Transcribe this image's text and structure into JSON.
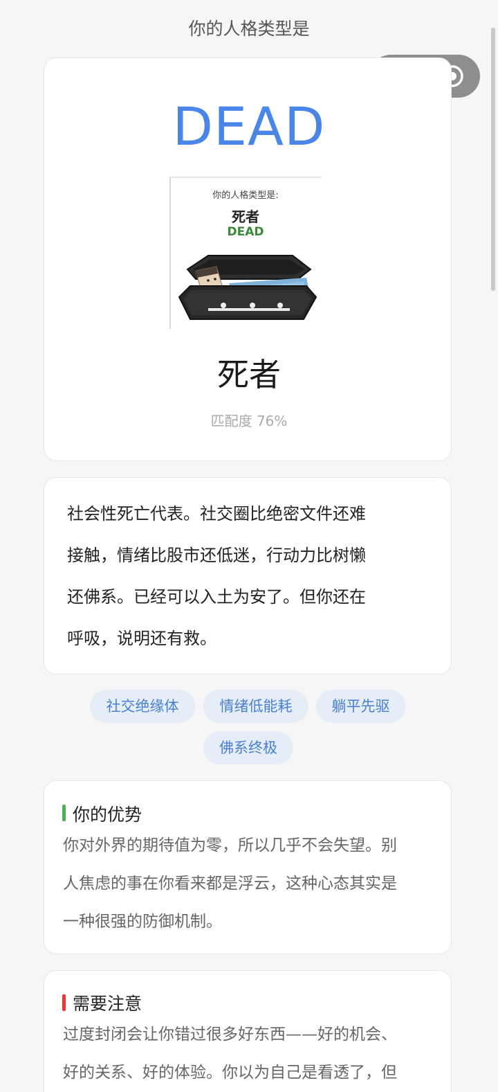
{
  "nav": {
    "title": "你的人格类型是"
  },
  "capsule": {
    "more_icon": "more-dots-icon",
    "close_icon": "target-circle-icon"
  },
  "result": {
    "code": "DEAD",
    "name": "死者",
    "match": "匹配度 76%",
    "meme": {
      "heading": "你的人格类型是:",
      "name": "死者",
      "code": "DEAD"
    }
  },
  "description": {
    "lines": [
      "社会性死亡代表。社交圈比绝密文件还难",
      "接触，情绪比股市还低迷，行动力比树懒",
      "还佛系。已经可以入土为安了。但你还在",
      "呼吸，说明还有救。"
    ]
  },
  "tags": [
    "社交绝缘体",
    "情绪低能耗",
    "躺平先驱",
    "佛系终极"
  ],
  "strengths": {
    "title": "你的优势",
    "accent": "#4caf50",
    "lines": [
      "你对外界的期待值为零，所以几乎不会失望。别",
      "人焦虑的事在你看来都是浮云，这种心态其实是",
      "一种很强的防御机制。"
    ]
  },
  "caution": {
    "title": "需要注意",
    "accent": "#e53935",
    "lines": [
      "过度封闭会让你错过很多好东西——好的机会、",
      "好的关系、好的体验。你以为自己是看透了，但"
    ]
  },
  "colors": {
    "code": "#4a86e8",
    "tag_bg": "#e5edf9",
    "tag_text": "#4a7fd0"
  }
}
